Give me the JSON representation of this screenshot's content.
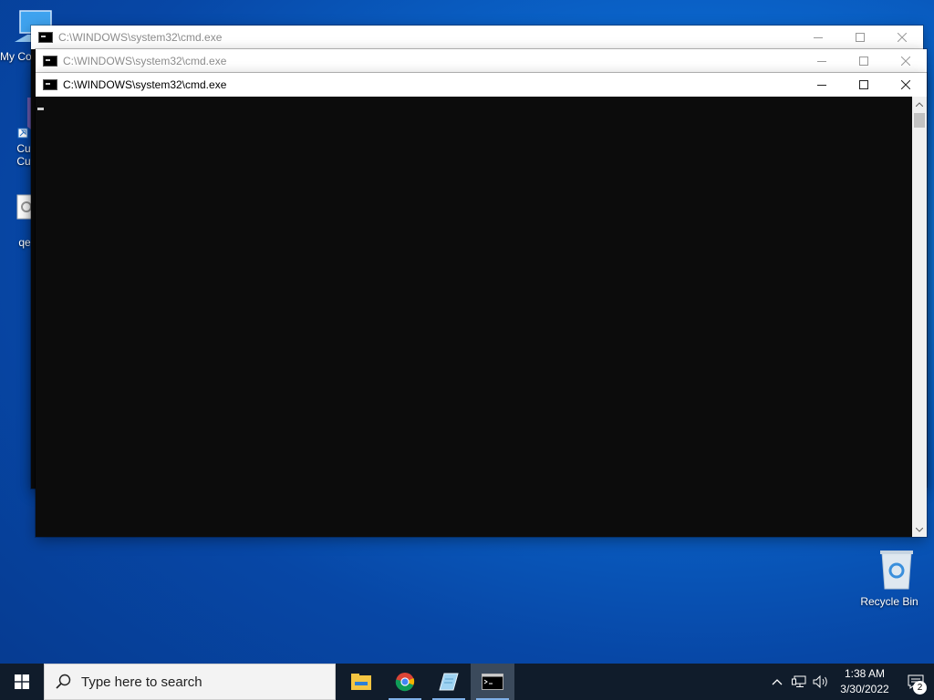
{
  "desktop": {
    "icons": [
      {
        "label": "My Co",
        "icon": "computer-icon"
      },
      {
        "label": "Cu\nCu",
        "icon": "shortcut-icon"
      },
      {
        "label": "qe",
        "icon": "setup-file-icon"
      },
      {
        "label": "Recycle Bin",
        "icon": "recycle-bin-icon"
      }
    ]
  },
  "windows": [
    {
      "title": "C:\\WINDOWS\\system32\\cmd.exe",
      "state": "inactive"
    },
    {
      "title": "C:\\WINDOWS\\system32\\cmd.exe",
      "state": "inactive"
    },
    {
      "title": "C:\\WINDOWS\\system32\\cmd.exe",
      "state": "active"
    }
  ],
  "taskbar": {
    "search_placeholder": "Type here to search",
    "apps": [
      {
        "name": "file-explorer-icon"
      },
      {
        "name": "chrome-icon"
      },
      {
        "name": "notepad-icon"
      },
      {
        "name": "command-prompt-icon",
        "active": true
      }
    ],
    "clock": {
      "time": "1:38 AM",
      "date": "3/30/2022"
    },
    "notification_count": "2"
  }
}
